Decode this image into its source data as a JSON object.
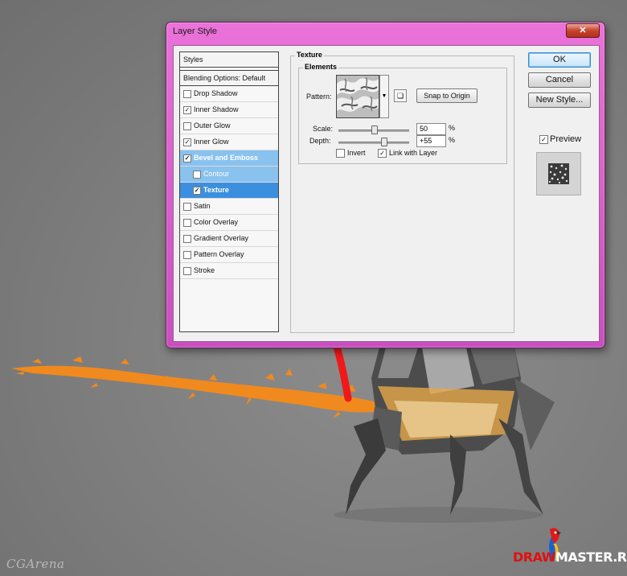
{
  "dialog": {
    "title": "Layer Style",
    "close_label": "✕"
  },
  "styles_panel": {
    "header": "Styles",
    "blending": "Blending Options: Default",
    "items": [
      {
        "label": "Drop Shadow",
        "checked": false
      },
      {
        "label": "Inner Shadow",
        "checked": true
      },
      {
        "label": "Outer Glow",
        "checked": false
      },
      {
        "label": "Inner Glow",
        "checked": true
      },
      {
        "label": "Bevel and Emboss",
        "checked": true
      },
      {
        "label": "Contour",
        "checked": false
      },
      {
        "label": "Texture",
        "checked": true
      },
      {
        "label": "Satin",
        "checked": false
      },
      {
        "label": "Color Overlay",
        "checked": false
      },
      {
        "label": "Gradient Overlay",
        "checked": false
      },
      {
        "label": "Pattern Overlay",
        "checked": false
      },
      {
        "label": "Stroke",
        "checked": false
      }
    ]
  },
  "texture": {
    "group_title": "Texture",
    "sub_title": "Elements",
    "pattern_label": "Pattern:",
    "snap_button": "Snap to Origin",
    "scale_label": "Scale:",
    "scale_value": "50",
    "scale_unit": "%",
    "scale_level": 0.5,
    "depth_label": "Depth:",
    "depth_value": "+55",
    "depth_unit": "%",
    "depth_level": 0.64,
    "invert_label": "Invert",
    "invert_checked": false,
    "link_label": "Link with Layer",
    "link_checked": true
  },
  "buttons": {
    "ok": "OK",
    "cancel": "Cancel",
    "new_style": "New Style...",
    "preview_label": "Preview",
    "preview_checked": true
  },
  "watermarks": {
    "left": "CGArena",
    "right_red": "DRAW",
    "right_white": "MASTER.RU"
  },
  "colors": {
    "title_bar": "#e466d6",
    "selection": "#3b8fde",
    "arrow": "#f01818",
    "splash": "#f08a1e"
  }
}
